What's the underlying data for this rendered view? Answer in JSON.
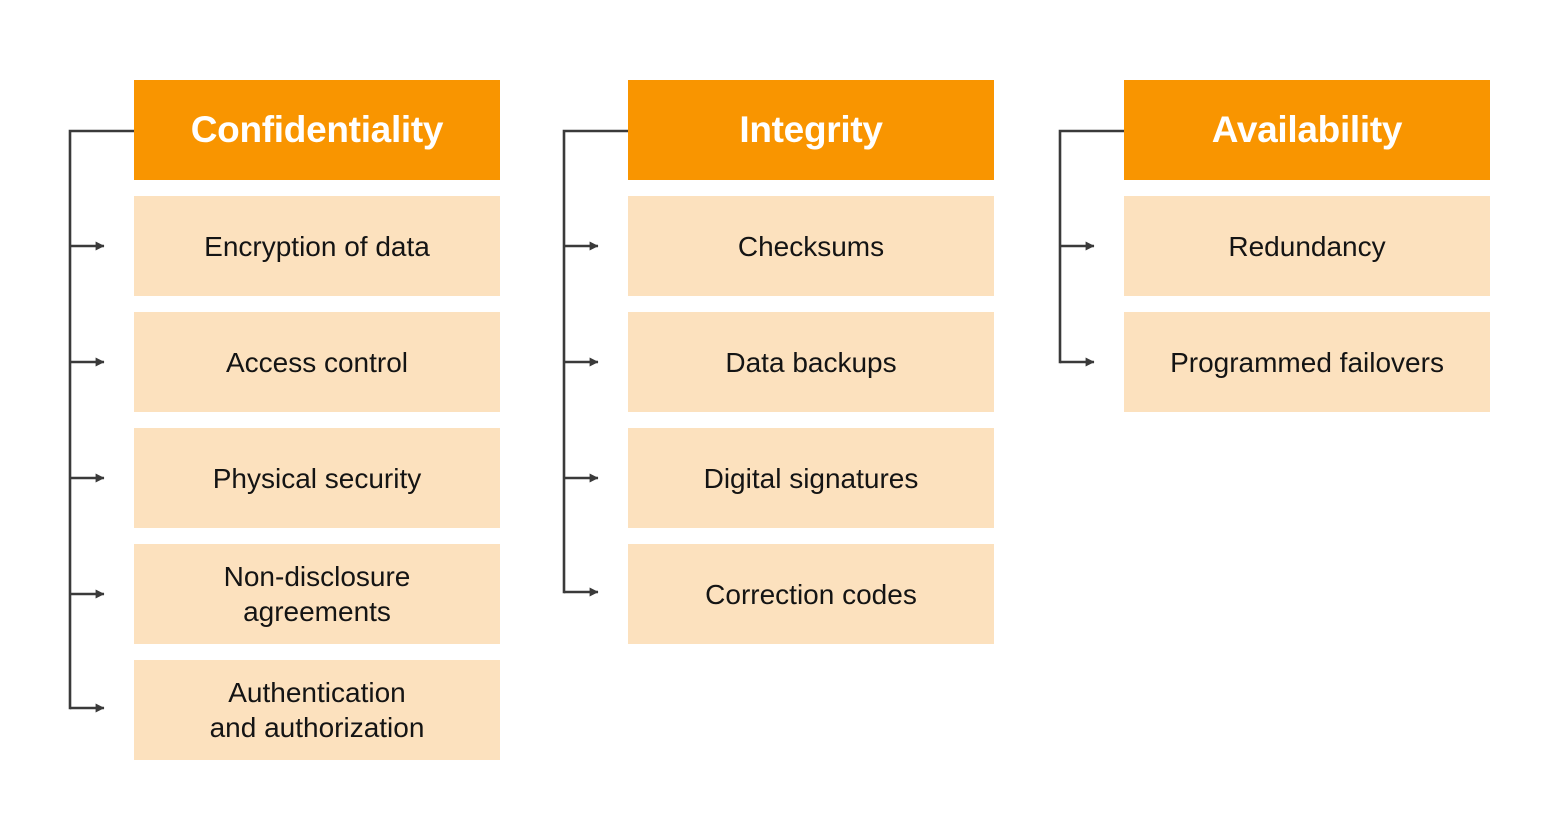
{
  "diagram": {
    "title": "CIA Triad security controls",
    "type": "three-column tree",
    "colors": {
      "background": "#ffffff",
      "header_fill": "#f99500",
      "header_text": "#ffffff",
      "item_fill": "#fce1be",
      "item_text": "#141414",
      "connector": "#3a3a3a"
    },
    "columns": [
      {
        "id": "confidentiality",
        "header": "Confidentiality",
        "items": [
          "Encryption of data",
          "Access control",
          "Physical security",
          "Non-disclosure\nagreements",
          "Authentication\nand authorization"
        ]
      },
      {
        "id": "integrity",
        "header": "Integrity",
        "items": [
          "Checksums",
          "Data backups",
          "Digital signatures",
          "Correction codes"
        ]
      },
      {
        "id": "availability",
        "header": "Availability",
        "items": [
          "Redundancy",
          "Programmed failovers"
        ]
      }
    ]
  }
}
